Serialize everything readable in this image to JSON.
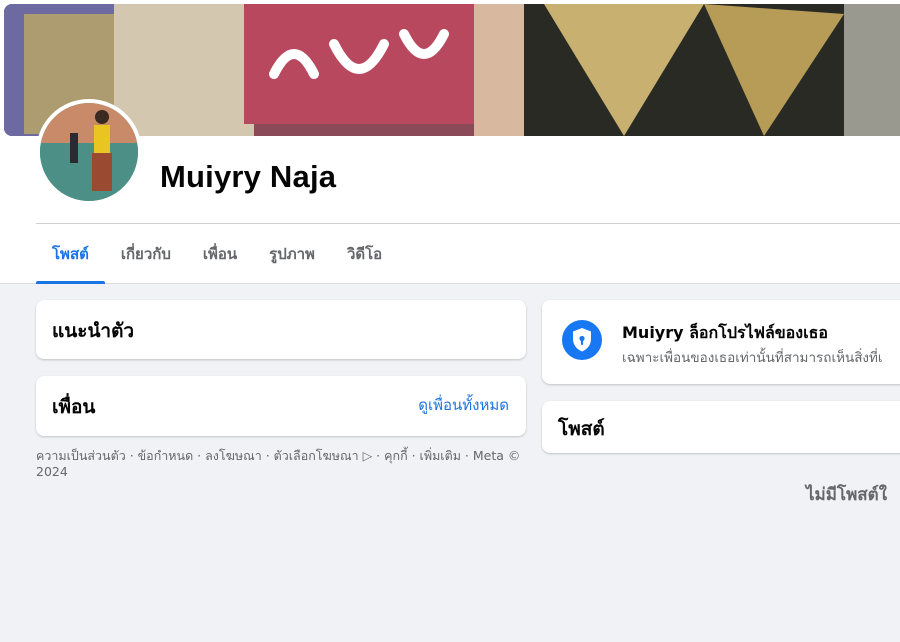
{
  "profile": {
    "name": "Muiyry Naja"
  },
  "tabs": [
    {
      "label": "โพสต์"
    },
    {
      "label": "เกี่ยวกับ"
    },
    {
      "label": "เพื่อน"
    },
    {
      "label": "รูปภาพ"
    },
    {
      "label": "วิดีโอ"
    }
  ],
  "intro": {
    "title": "แนะนำตัว"
  },
  "friends": {
    "title": "เพื่อน",
    "see_all": "ดูเพื่อนทั้งหมด"
  },
  "footer": {
    "text": "ความเป็นส่วนตัว · ข้อกำหนด · ลงโฆษณา · ตัวเลือกโฆษณา ▷ · คุกกี้ · เพิ่มเติม · Meta © 2024"
  },
  "locked_notice": {
    "title": "Muiyry ล็อกโปรไฟล์ของเธอ",
    "subtitle": "เฉพาะเพื่อนของเธอเท่านั้นที่สามารถเห็นสิ่งที่เ"
  },
  "posts": {
    "title": "โพสต์",
    "empty": "ไม่มีโพสต์ใ"
  },
  "colors": {
    "accent": "#1b74e4",
    "background": "#f0f2f5",
    "secondary_text": "#65676b"
  }
}
